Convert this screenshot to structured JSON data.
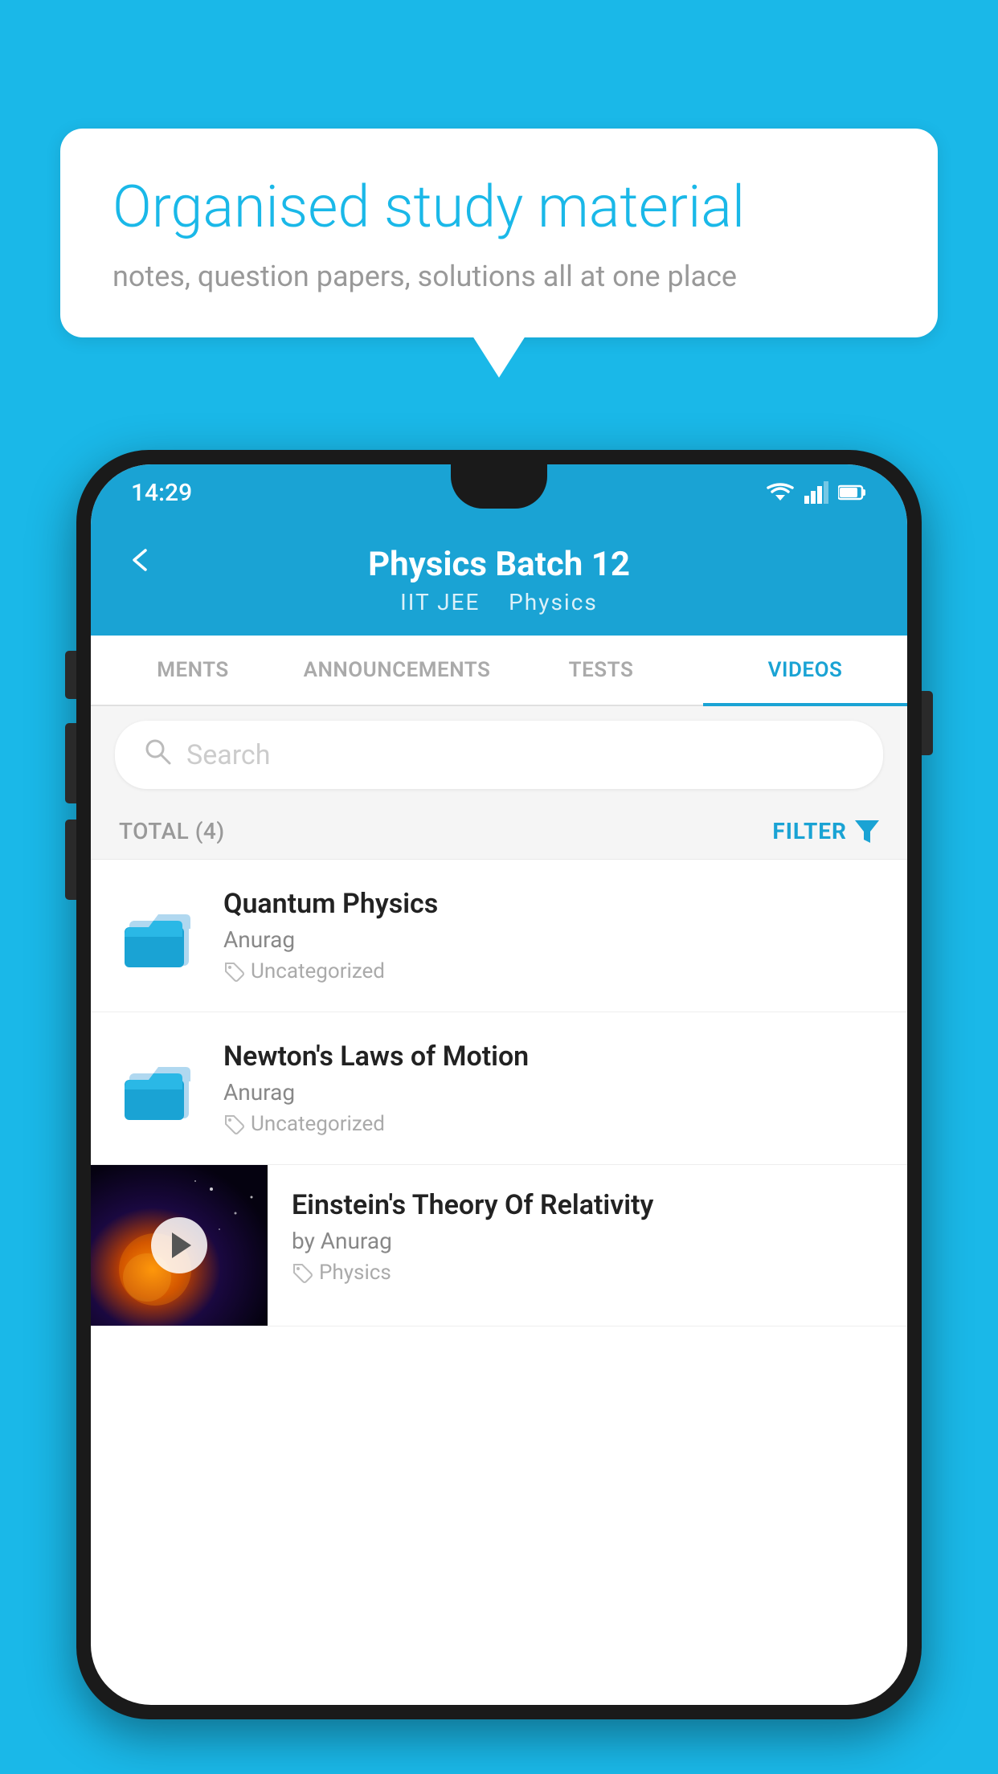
{
  "bubble": {
    "title": "Organised study material",
    "subtitle": "notes, question papers, solutions all at one place"
  },
  "status_bar": {
    "time": "14:29"
  },
  "app_bar": {
    "title": "Physics Batch 12",
    "subtitle_parts": [
      "IIT JEE",
      "Physics"
    ],
    "back_label": "←"
  },
  "tabs": [
    {
      "label": "MENTS",
      "active": false
    },
    {
      "label": "ANNOUNCEMENTS",
      "active": false
    },
    {
      "label": "TESTS",
      "active": false
    },
    {
      "label": "VIDEOS",
      "active": true
    }
  ],
  "search": {
    "placeholder": "Search"
  },
  "filter_bar": {
    "total_label": "TOTAL (4)",
    "filter_label": "FILTER"
  },
  "videos": [
    {
      "title": "Quantum Physics",
      "author": "Anurag",
      "tag": "Uncategorized",
      "has_thumbnail": false
    },
    {
      "title": "Newton's Laws of Motion",
      "author": "Anurag",
      "tag": "Uncategorized",
      "has_thumbnail": false
    },
    {
      "title": "Einstein's Theory Of Relativity",
      "author": "by Anurag",
      "tag": "Physics",
      "has_thumbnail": true
    }
  ]
}
